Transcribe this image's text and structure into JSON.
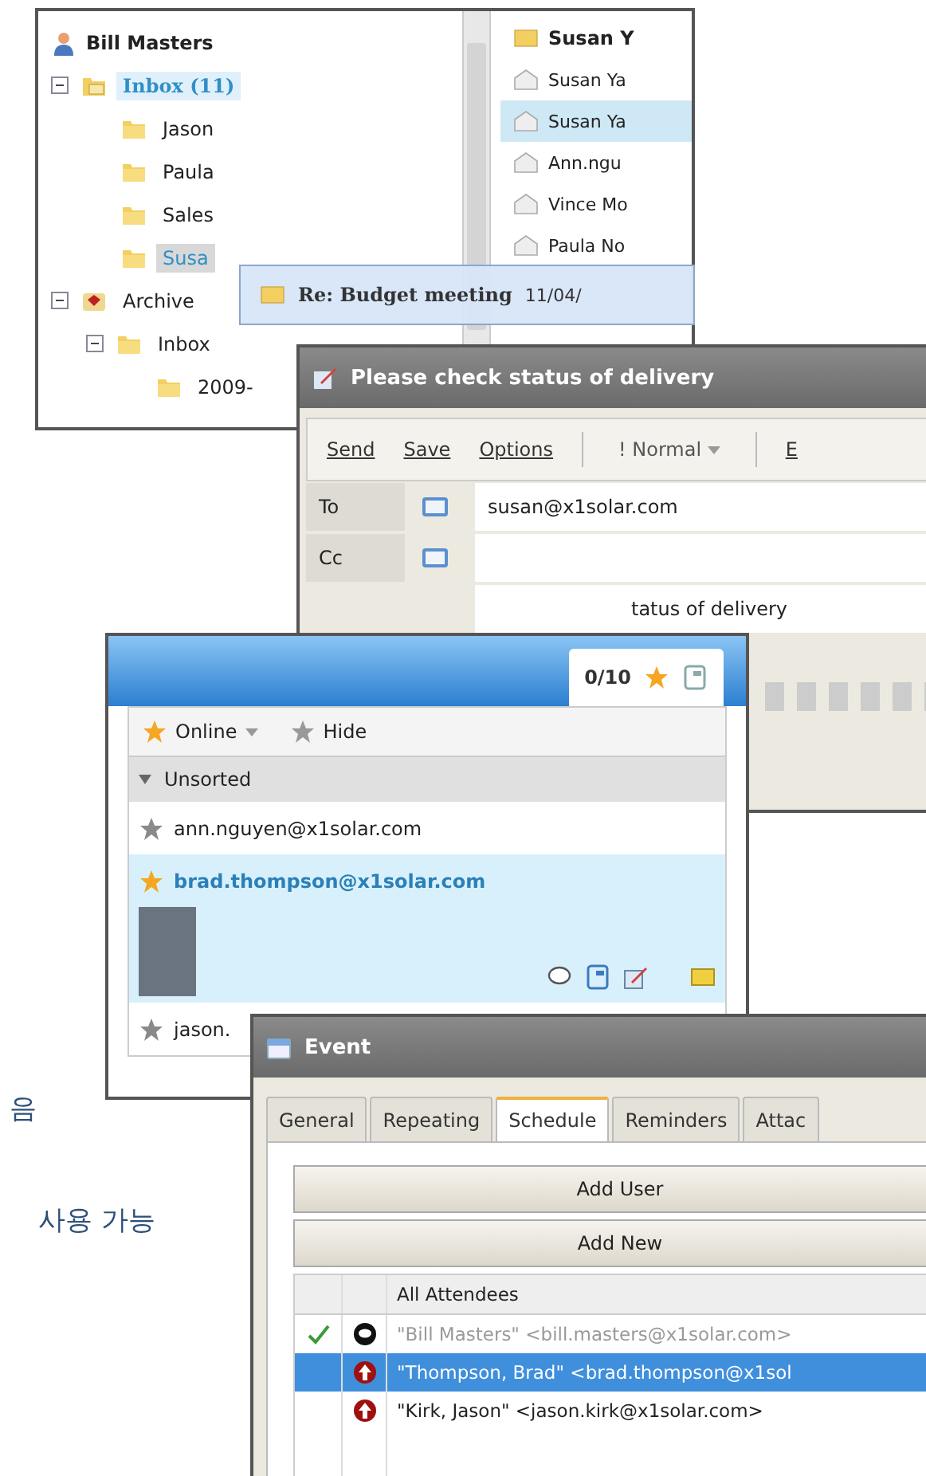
{
  "mail_window": {
    "account": "Bill Masters",
    "folders": [
      {
        "label": "Inbox (11)",
        "kind": "inbox",
        "expanded": true,
        "selected": true,
        "highlighted": false,
        "children": [
          {
            "label": "Jason",
            "kind": "folder",
            "selected": false,
            "highlighted": false
          },
          {
            "label": "Paula",
            "kind": "folder",
            "selected": false,
            "highlighted": false
          },
          {
            "label": "Sales",
            "kind": "folder",
            "selected": false,
            "highlighted": false
          },
          {
            "label": "Susa",
            "kind": "folder",
            "selected": false,
            "highlighted": true
          }
        ]
      },
      {
        "label": "Archive",
        "kind": "archive",
        "expanded": true,
        "selected": false,
        "highlighted": false,
        "children": [
          {
            "label": "Inbox",
            "kind": "folder",
            "expanded": true,
            "selected": false,
            "highlighted": false,
            "children": [
              {
                "label": "2009-",
                "kind": "folder",
                "selected": false,
                "highlighted": false
              }
            ]
          }
        ]
      }
    ],
    "messages": [
      {
        "sender": "Susan Y",
        "unread": true,
        "selected": false
      },
      {
        "sender": "Susan Ya",
        "unread": false,
        "selected": false
      },
      {
        "sender": "Susan Ya",
        "unread": false,
        "selected": true
      },
      {
        "sender": "Ann.ngu",
        "unread": false,
        "selected": false
      },
      {
        "sender": "Vince Mo",
        "unread": false,
        "selected": false
      },
      {
        "sender": "Paula No",
        "unread": false,
        "selected": false
      }
    ]
  },
  "drag_tooltip": {
    "subject": "Re: Budget meeting",
    "date": "11/04/"
  },
  "compose_window": {
    "title": "Please check status of delivery",
    "actions": [
      "Send",
      "Save",
      "Options"
    ],
    "priority": "! Normal",
    "cut_action": "E",
    "recipients": [
      {
        "label": "To",
        "value": "susan@x1solar.com"
      },
      {
        "label": "Cc"
      }
    ],
    "subject": "tatus of delivery"
  },
  "contacts_window": {
    "count": "0/10",
    "status": "Online",
    "hide": "Hide",
    "group": {
      "label": "Unsorted",
      "expanded": true
    },
    "contacts": [
      {
        "name": "ann.nguyen@x1solar.com",
        "online": false,
        "selected": false
      },
      {
        "name": "brad.thompson@x1solar.com",
        "online": true,
        "selected": true
      },
      {
        "name": "jason.",
        "online": false,
        "selected": false
      }
    ]
  },
  "event_window": {
    "title": "Event",
    "tabs": [
      {
        "label": "General",
        "selected": false
      },
      {
        "label": "Repeating",
        "selected": false
      },
      {
        "label": "Schedule",
        "selected": true
      },
      {
        "label": "Reminders",
        "selected": false
      },
      {
        "label": "Attac",
        "selected": false
      }
    ],
    "buttons": [
      "Add User",
      "Add New"
    ],
    "attendees_header": "All Attendees",
    "attendees": [
      {
        "name": "\"Bill Masters\" <bill.masters@x1solar.com>",
        "kind": "organizer",
        "accepted": true,
        "selected": false
      },
      {
        "name": "\"Thompson, Brad\" <brad.thompson@x1sol",
        "kind": "attendee",
        "accepted": false,
        "selected": true
      },
      {
        "name": "\"Kirk, Jason\" <jason.kirk@x1solar.com>",
        "kind": "attendee",
        "accepted": false,
        "selected": false
      }
    ]
  },
  "side_notes": [
    "음",
    "사용 가능"
  ]
}
